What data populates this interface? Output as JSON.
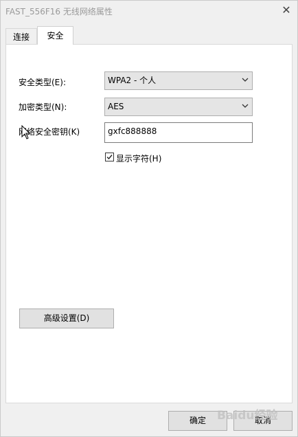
{
  "window": {
    "title": "FAST_556F16 无线网络属性",
    "close_glyph": "✕"
  },
  "tabs": [
    {
      "label": "连接",
      "selected": false
    },
    {
      "label": "安全",
      "selected": true
    }
  ],
  "security": {
    "type_label": "安全类型(E):",
    "type_value": "WPA2 - 个人",
    "encryption_label": "加密类型(N):",
    "encryption_value": "AES",
    "key_label": "网络安全密钥(K)",
    "key_value": "gxfc888888",
    "show_chars_label": "显示字符(H)",
    "show_chars_checked": true
  },
  "buttons": {
    "advanced": "高级设置(D)",
    "ok": "确定",
    "cancel": "取消"
  },
  "watermark": "Baidu经验"
}
